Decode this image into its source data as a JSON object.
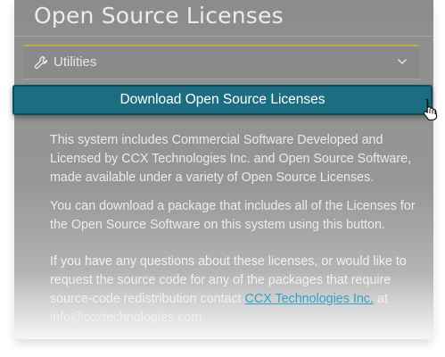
{
  "panel": {
    "title": "Open Source Licenses"
  },
  "accordion": {
    "label": "Utilities",
    "icon": "wrench-icon",
    "toggle_icon": "chevron-down-icon",
    "accent_color": "#c9a64a"
  },
  "download_button": {
    "label": "Download Open Source Licenses",
    "color": "#1c6d82"
  },
  "content": {
    "paragraph_1": "This system includes Commercial Software Developed and Licensed by CCX Technologies Inc. and Open Source Software, made available under a variety of Open Source Licenses.",
    "paragraph_2": "You can download a package that includes all of the Licenses for the Open Source Software on this system using this button.",
    "paragraph_3_before_link": "If you have any questions about these licenses, or would like to request the source code for any of the packages that require source-code redistribution contact ",
    "paragraph_3_link": "CCX Technologies Inc.",
    "paragraph_3_after_link": " at info@ccxtechnologies.com."
  },
  "cursor": {
    "icon": "hand-pointer-icon"
  }
}
